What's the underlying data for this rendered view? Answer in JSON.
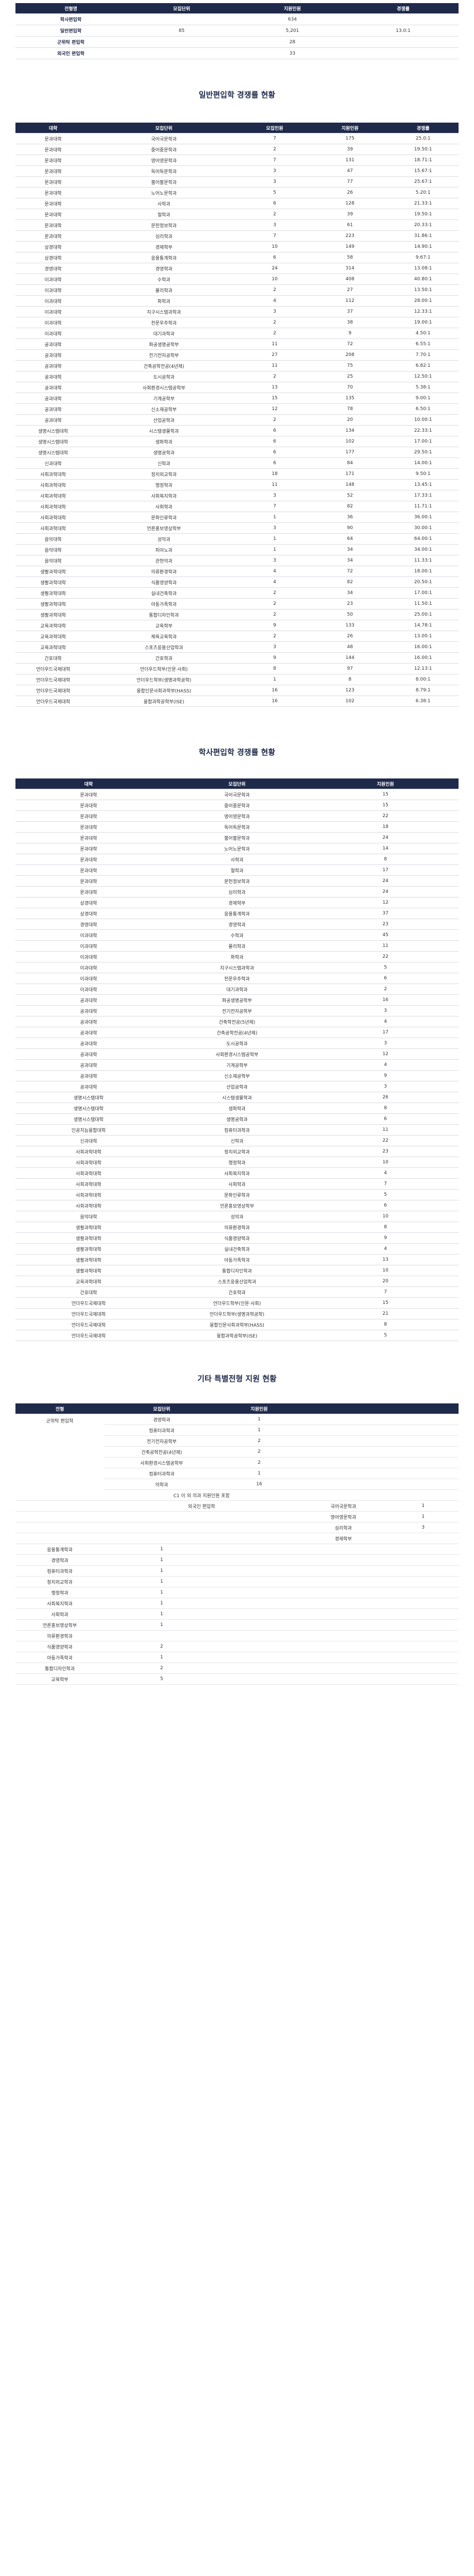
{
  "summary": {
    "headers": [
      "전형명",
      "모집단위",
      "지원인원",
      "경쟁률"
    ],
    "rows": [
      {
        "name": "학사편입학",
        "unit": "",
        "applicants": "634",
        "rate": ""
      },
      {
        "name": "일반편입학",
        "unit": "85",
        "applicants": "5,201",
        "rate": "13.0:1"
      },
      {
        "name": "군위탁 편입학",
        "unit": "",
        "applicants": "28",
        "rate": ""
      },
      {
        "name": "외국인 편입학",
        "unit": "",
        "applicants": "33",
        "rate": ""
      }
    ]
  },
  "general": {
    "title": "일반편입학 경쟁률 현황",
    "headers": [
      "대학",
      "모집단위",
      "모집인원",
      "지원인원",
      "경쟁률"
    ],
    "rows": [
      [
        "문과대학",
        "국어국문학과",
        "7",
        "175",
        "25.0:1"
      ],
      [
        "문과대학",
        "중어중문학과",
        "2",
        "39",
        "19.50:1"
      ],
      [
        "문과대학",
        "영어영문학과",
        "7",
        "131",
        "18.71:1"
      ],
      [
        "문과대학",
        "독어독문학과",
        "3",
        "47",
        "15.67:1"
      ],
      [
        "문과대학",
        "불어불문학과",
        "3",
        "77",
        "25.67:1"
      ],
      [
        "문과대학",
        "노어노문학과",
        "5",
        "26",
        "5.20:1"
      ],
      [
        "문과대학",
        "사학과",
        "6",
        "128",
        "21.33:1"
      ],
      [
        "문과대학",
        "철학과",
        "2",
        "39",
        "19.50:1"
      ],
      [
        "문과대학",
        "문헌정보학과",
        "3",
        "61",
        "20.33:1"
      ],
      [
        "문과대학",
        "심리학과",
        "7",
        "223",
        "31.86:1"
      ],
      [
        "상경대학",
        "경제학부",
        "10",
        "149",
        "14.90:1"
      ],
      [
        "상경대학",
        "응용통계학과",
        "6",
        "58",
        "9.67:1"
      ],
      [
        "경영대학",
        "경영학과",
        "24",
        "314",
        "13.08:1"
      ],
      [
        "이과대학",
        "수학과",
        "10",
        "408",
        "40.80:1"
      ],
      [
        "이과대학",
        "물리학과",
        "2",
        "27",
        "13.50:1"
      ],
      [
        "이과대학",
        "화학과",
        "4",
        "112",
        "28.00:1"
      ],
      [
        "이과대학",
        "지구시스템과학과",
        "3",
        "37",
        "12.33:1"
      ],
      [
        "이과대학",
        "천문우주학과",
        "2",
        "38",
        "19.00:1"
      ],
      [
        "이과대학",
        "대기과학과",
        "2",
        "9",
        "4.50:1"
      ],
      [
        "공과대학",
        "화공생명공학부",
        "11",
        "72",
        "6.55:1"
      ],
      [
        "공과대학",
        "전기전자공학부",
        "27",
        "208",
        "7.70:1"
      ],
      [
        "공과대학",
        "건축공학전공(4년제)",
        "11",
        "75",
        "6.82:1"
      ],
      [
        "공과대학",
        "도시공학과",
        "2",
        "25",
        "12.50:1"
      ],
      [
        "공과대학",
        "사회환경시스템공학부",
        "13",
        "70",
        "5.38:1"
      ],
      [
        "공과대학",
        "기계공학부",
        "15",
        "135",
        "9.00:1"
      ],
      [
        "공과대학",
        "신소재공학부",
        "12",
        "78",
        "6.50:1"
      ],
      [
        "공과대학",
        "산업공학과",
        "2",
        "20",
        "10.00:1"
      ],
      [
        "생명시스템대학",
        "시스템생물학과",
        "6",
        "134",
        "22.33:1"
      ],
      [
        "생명시스템대학",
        "생화학과",
        "6",
        "102",
        "17.00:1"
      ],
      [
        "생명시스템대학",
        "생명공학과",
        "6",
        "177",
        "29.50:1"
      ],
      [
        "신과대학",
        "신학과",
        "6",
        "84",
        "14.00:1"
      ],
      [
        "사회과학대학",
        "정치외교학과",
        "18",
        "171",
        "9.50:1"
      ],
      [
        "사회과학대학",
        "행정학과",
        "11",
        "148",
        "13.45:1"
      ],
      [
        "사회과학대학",
        "사회복지학과",
        "3",
        "52",
        "17.33:1"
      ],
      [
        "사회과학대학",
        "사회학과",
        "7",
        "82",
        "11.71:1"
      ],
      [
        "사회과학대학",
        "문화인류학과",
        "1",
        "36",
        "36.00:1"
      ],
      [
        "사회과학대학",
        "언론홍보영상학부",
        "3",
        "90",
        "30.00:1"
      ],
      [
        "음악대학",
        "성악과",
        "1",
        "64",
        "64.00:1"
      ],
      [
        "음악대학",
        "피아노과",
        "1",
        "34",
        "34.00:1"
      ],
      [
        "음악대학",
        "관현악과",
        "3",
        "34",
        "11.33:1"
      ],
      [
        "생활과학대학",
        "의류환경학과",
        "4",
        "72",
        "18.00:1"
      ],
      [
        "생활과학대학",
        "식품영양학과",
        "4",
        "82",
        "20.50:1"
      ],
      [
        "생활과학대학",
        "실내건축학과",
        "2",
        "34",
        "17.00:1"
      ],
      [
        "생활과학대학",
        "아동가족학과",
        "2",
        "23",
        "11.50:1"
      ],
      [
        "생활과학대학",
        "통합디자인학과",
        "2",
        "50",
        "25.00:1"
      ],
      [
        "교육과학대학",
        "교육학부",
        "9",
        "133",
        "14.78:1"
      ],
      [
        "교육과학대학",
        "체육교육학과",
        "2",
        "26",
        "13.00:1"
      ],
      [
        "교육과학대학",
        "스포츠응용산업학과",
        "3",
        "48",
        "16.00:1"
      ],
      [
        "간호대학",
        "간호학과",
        "9",
        "144",
        "16.00:1"
      ],
      [
        "언더우드국제대학",
        "언더우드학부(인문·사회)",
        "8",
        "97",
        "12.13:1"
      ],
      [
        "언더우드국제대학",
        "언더우드학부(생명과학공학)",
        "1",
        "8",
        "8.00:1"
      ],
      [
        "언더우드국제대학",
        "융합인문사회과학부(HASS)",
        "16",
        "123",
        "8.79:1"
      ],
      [
        "언더우드국제대학",
        "융합과학공학부(ISE)",
        "16",
        "102",
        "6.38:1"
      ]
    ]
  },
  "bachelor": {
    "title": "학사편입학 경쟁률 현황",
    "headers": [
      "대학",
      "모집단위",
      "지원인원"
    ],
    "rows": [
      [
        "문과대학",
        "국어국문학과",
        "15"
      ],
      [
        "문과대학",
        "중어중문학과",
        "15"
      ],
      [
        "문과대학",
        "영어영문학과",
        "22"
      ],
      [
        "문과대학",
        "독어독문학과",
        "18"
      ],
      [
        "문과대학",
        "불어불문학과",
        "24"
      ],
      [
        "문과대학",
        "노어노문학과",
        "14"
      ],
      [
        "문과대학",
        "사학과",
        "8"
      ],
      [
        "문과대학",
        "철학과",
        "17"
      ],
      [
        "문과대학",
        "문헌정보학과",
        "24"
      ],
      [
        "문과대학",
        "심리학과",
        "24"
      ],
      [
        "상경대학",
        "경제학부",
        "12"
      ],
      [
        "상경대학",
        "응용통계학과",
        "37"
      ],
      [
        "경영대학",
        "경영학과",
        "23"
      ],
      [
        "이과대학",
        "수학과",
        "45"
      ],
      [
        "이과대학",
        "물리학과",
        "11"
      ],
      [
        "이과대학",
        "화학과",
        "22"
      ],
      [
        "이과대학",
        "지구시스템과학과",
        "5"
      ],
      [
        "이과대학",
        "천문우주학과",
        "6"
      ],
      [
        "이과대학",
        "대기과학과",
        "2"
      ],
      [
        "공과대학",
        "화공생명공학부",
        "16"
      ],
      [
        "공과대학",
        "전기전자공학부",
        "3"
      ],
      [
        "공과대학",
        "건축학전공(5년제)",
        "4"
      ],
      [
        "공과대학",
        "건축공학전공(4년제)",
        "17"
      ],
      [
        "공과대학",
        "도시공학과",
        "3"
      ],
      [
        "공과대학",
        "사회환경시스템공학부",
        "12"
      ],
      [
        "공과대학",
        "기계공학부",
        "4"
      ],
      [
        "공과대학",
        "신소재공학부",
        "9"
      ],
      [
        "공과대학",
        "산업공학과",
        "3"
      ],
      [
        "생명시스템대학",
        "시스템생물학과",
        "26"
      ],
      [
        "생명시스템대학",
        "생화학과",
        "8"
      ],
      [
        "생명시스템대학",
        "생명공학과",
        "6"
      ],
      [
        "인공지능융합대학",
        "컴퓨터과학과",
        "11"
      ],
      [
        "신과대학",
        "신학과",
        "22"
      ],
      [
        "사회과학대학",
        "정치외교학과",
        "23"
      ],
      [
        "사회과학대학",
        "행정학과",
        "10"
      ],
      [
        "사회과학대학",
        "사회복지학과",
        "4"
      ],
      [
        "사회과학대학",
        "사회학과",
        "7"
      ],
      [
        "사회과학대학",
        "문화인류학과",
        "5"
      ],
      [
        "사회과학대학",
        "언론홍보영상학부",
        "6"
      ],
      [
        "음악대학",
        "성악과",
        "10"
      ],
      [
        "생활과학대학",
        "의류환경학과",
        "8"
      ],
      [
        "생활과학대학",
        "식품영양학과",
        "9"
      ],
      [
        "생활과학대학",
        "실내건축학과",
        "4"
      ],
      [
        "생활과학대학",
        "아동가족학과",
        "13"
      ],
      [
        "생활과학대학",
        "통합디자인학과",
        "10"
      ],
      [
        "교육과학대학",
        "스포츠응용산업학과",
        "20"
      ],
      [
        "간호대학",
        "간호학과",
        "7"
      ],
      [
        "언더우드국제대학",
        "언더우드학부(인문·사회)",
        "15"
      ],
      [
        "언더우드국제대학",
        "언더우드학부(생명과학공학)",
        "21"
      ],
      [
        "언더우드국제대학",
        "융합인문사회과학부(HASS)",
        "8"
      ],
      [
        "언더우드국제대학",
        "융합과학공학부(ISE)",
        "5"
      ]
    ]
  },
  "other": {
    "title": "기타 특별전형 지원 현황",
    "headers": [
      "전형",
      "모집단위",
      "지원인원"
    ],
    "military": {
      "group": "군위탁 편입학",
      "rows": [
        [
          "경영학과",
          "1"
        ],
        [
          "컴퓨터과학과",
          "1"
        ],
        [
          "전기전자공학부",
          "2"
        ],
        [
          "건축공학전공(4년제)",
          "2"
        ],
        [
          "사회환경시스템공학부",
          "2"
        ],
        [
          "컴퓨터과학과",
          "1"
        ],
        [
          "의학과",
          "16"
        ]
      ],
      "note": "C1 이 외 의과 지원인원 포함"
    },
    "foreign": {
      "group": "외국인 편입학",
      "right_rows": [
        [
          "국어국문학과",
          "1"
        ],
        [
          "영어영문학과",
          "1"
        ],
        [
          "심리학과",
          "3"
        ],
        [
          "경제학부",
          ""
        ]
      ],
      "rows": [
        [
          "응용통계학과",
          "1"
        ],
        [
          "경영학과",
          "1"
        ],
        [
          "컴퓨터과학과",
          "1"
        ],
        [
          "정치외교학과",
          "1"
        ],
        [
          "행정학과",
          "1"
        ],
        [
          "사회복지학과",
          "1"
        ],
        [
          "사회학과",
          "1"
        ],
        [
          "언론홍보영상학부",
          "1"
        ],
        [
          "의류환경학과",
          ""
        ],
        [
          "식품영양학과",
          "2"
        ],
        [
          "아동가족학과",
          "1"
        ],
        [
          "통합디자인학과",
          "2"
        ],
        [
          "교육학부",
          "5"
        ]
      ]
    }
  }
}
